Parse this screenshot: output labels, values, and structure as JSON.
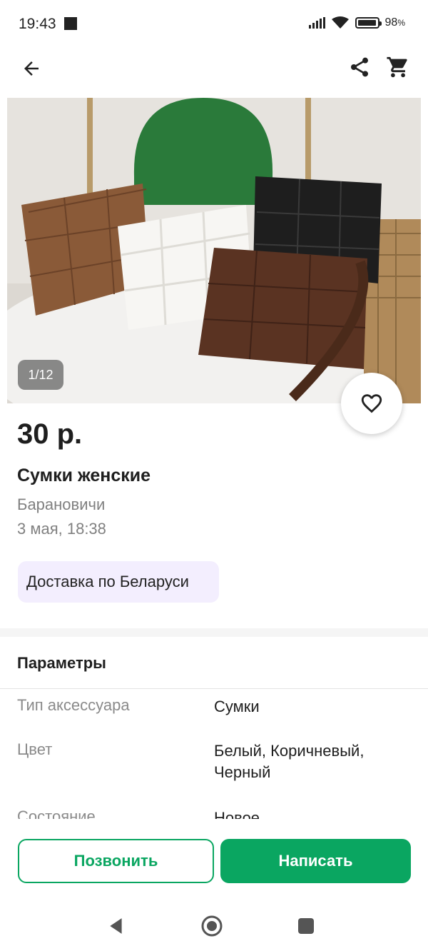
{
  "status_bar": {
    "time": "19:43",
    "battery_label": "98",
    "battery_percent_sign": "%",
    "battery_level": 0.98
  },
  "app_bar": {
    "back_icon": "arrow-back-icon",
    "share_icon": "share-icon",
    "cart_icon": "cart-icon"
  },
  "gallery": {
    "counter": "1/12",
    "current": 1,
    "total": 12
  },
  "listing": {
    "price": "30 р.",
    "title": "Сумки женские",
    "city": "Барановичи",
    "date": "3 мая, 18:38",
    "delivery_badge": "Доставка по Беларуси"
  },
  "params": {
    "heading": "Параметры",
    "rows": [
      {
        "label": "Тип аксессуара",
        "value": "Сумки"
      },
      {
        "label": "Цвет",
        "value": "Белый, Коричневый, Черный"
      },
      {
        "label": "Состояние",
        "value": "Новое"
      }
    ]
  },
  "actions": {
    "call_label": "Позвонить",
    "write_label": "Написать"
  },
  "colors": {
    "accent_green": "#0aa661",
    "delivery_badge_bg": "#f3eefe",
    "muted_text": "#808080"
  }
}
